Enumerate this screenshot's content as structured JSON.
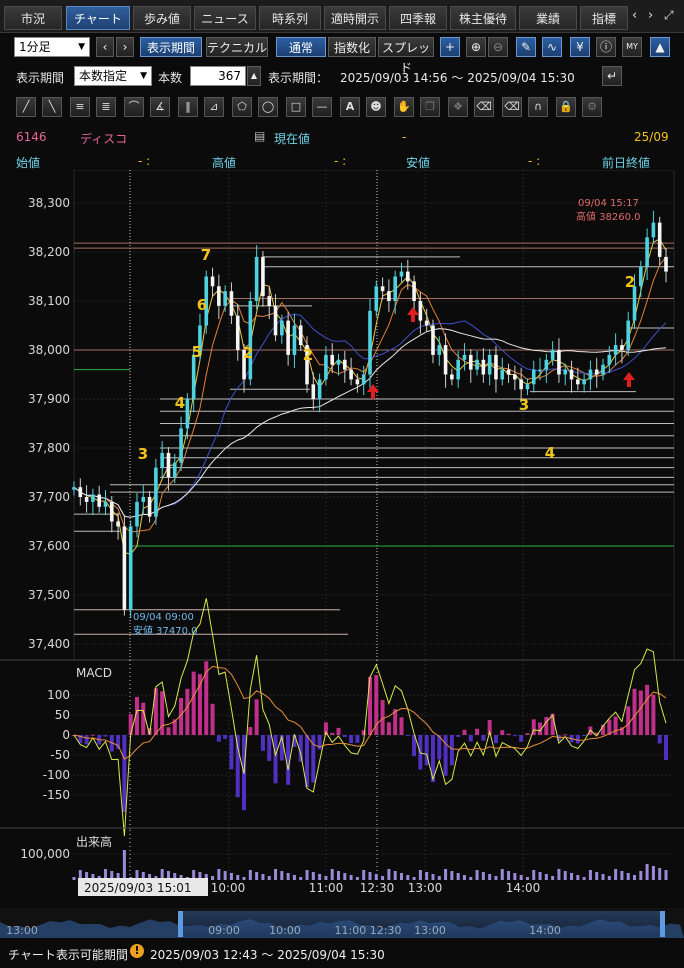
{
  "tabs": [
    "市況",
    "チャート",
    "歩み値",
    "ニュース",
    "時系列",
    "適時開示",
    "四季報",
    "株主優待",
    "業績",
    "指標"
  ],
  "tab_active_index": 1,
  "toolbar": {
    "interval": "1分足",
    "period_button": "表示期間",
    "technical_button": "テクニカル",
    "normal_button": "通常",
    "index_button": "指数化",
    "spread_button": "スプレッド"
  },
  "period_row": {
    "label": "表示期間",
    "mode": "本数指定",
    "count_label": "本数",
    "count_value": "367",
    "range_label": "表示期間：",
    "range_value": "2025/09/03 14:56 〜 2025/09/04 15:30"
  },
  "stock": {
    "code": "6146",
    "name": "ディスコ",
    "current_label": "現在値",
    "current_value": "-",
    "date": "25/09",
    "open_label": "始値",
    "open_value": "-  :",
    "high_label": "高値",
    "high_value": "-  :",
    "low_label": "安値",
    "low_value": "-  :",
    "prev_label": "前日終値"
  },
  "chart_data": [
    {
      "type": "candlestick",
      "title": "",
      "ylim": [
        37400,
        38300
      ],
      "yticks": [
        "38,300",
        "38,200",
        "38,100",
        "38,000",
        "37,900",
        "37,800",
        "37,700",
        "37,600",
        "37,500",
        "37,400"
      ],
      "high_annotation": {
        "time": "09/04 15:17",
        "label": "高値 38260.0"
      },
      "low_annotation": {
        "time": "09/04 09:00",
        "label": "安値 37470.0"
      },
      "wave_labels": [
        "7",
        "6",
        "5",
        "4",
        "3",
        "2",
        "2",
        "3",
        "4",
        "2"
      ],
      "price_path": [
        37720,
        37700,
        37690,
        37705,
        37680,
        37690,
        37650,
        37640,
        37470,
        37640,
        37690,
        37700,
        37660,
        37760,
        37790,
        37740,
        37770,
        37840,
        37900,
        37990,
        38050,
        38150,
        38130,
        38090,
        38120,
        38070,
        38000,
        37940,
        38100,
        38190,
        38110,
        38090,
        38030,
        38060,
        37990,
        38050,
        38010,
        37930,
        37900,
        37940,
        37990,
        37970,
        37980,
        37960,
        37940,
        37930,
        37950,
        38080,
        38130,
        38120,
        38100,
        38150,
        38160,
        38140,
        38100,
        38060,
        38050,
        37990,
        38010,
        37950,
        37940,
        37980,
        37990,
        37960,
        37980,
        37950,
        37990,
        37940,
        37960,
        37950,
        37940,
        37920,
        37930,
        37960,
        37960,
        37980,
        38000,
        37950,
        37960,
        37940,
        37930,
        37940,
        37960,
        37950,
        37970,
        37990,
        38010,
        38000,
        38060,
        38130,
        38170,
        38230,
        38260,
        38190,
        38160
      ]
    },
    {
      "type": "line",
      "title": "MACD",
      "ylim": [
        -150,
        100
      ],
      "yticks": [
        "100",
        "50",
        "0",
        "-50",
        "-100",
        "-150"
      ]
    },
    {
      "type": "bar",
      "title": "出来高",
      "yticks": [
        "100,000"
      ]
    }
  ],
  "time_axis": {
    "cursor_label": "2025/09/03 15:01",
    "labels": [
      "10:00",
      "11:00",
      "12:30",
      "13:00",
      "14:00"
    ]
  },
  "navigator": {
    "labels": [
      "13:00",
      "09:00",
      "10:00",
      "11:00 12:30",
      "13:00",
      "14:00"
    ]
  },
  "footer": {
    "label": "チャート表示可能期間",
    "range": "2025/09/03 12:43 〜 2025/09/04 15:30"
  },
  "colors": {
    "pink": "#e8649b",
    "cyan": "#6fd4e8",
    "gold": "#f0c419",
    "up_candle": "#4fd2e0",
    "down_candle": "#ffffff"
  }
}
